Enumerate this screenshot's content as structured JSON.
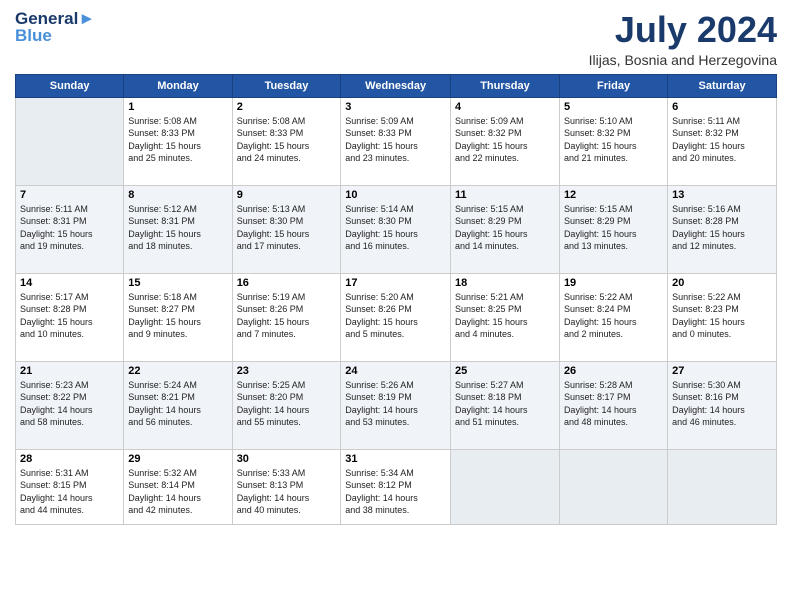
{
  "header": {
    "logo_general": "General",
    "logo_blue": "Blue",
    "title": "July 2024",
    "location": "Ilijas, Bosnia and Herzegovina"
  },
  "days_of_week": [
    "Sunday",
    "Monday",
    "Tuesday",
    "Wednesday",
    "Thursday",
    "Friday",
    "Saturday"
  ],
  "weeks": [
    [
      {
        "num": "",
        "info": ""
      },
      {
        "num": "1",
        "info": "Sunrise: 5:08 AM\nSunset: 8:33 PM\nDaylight: 15 hours\nand 25 minutes."
      },
      {
        "num": "2",
        "info": "Sunrise: 5:08 AM\nSunset: 8:33 PM\nDaylight: 15 hours\nand 24 minutes."
      },
      {
        "num": "3",
        "info": "Sunrise: 5:09 AM\nSunset: 8:33 PM\nDaylight: 15 hours\nand 23 minutes."
      },
      {
        "num": "4",
        "info": "Sunrise: 5:09 AM\nSunset: 8:32 PM\nDaylight: 15 hours\nand 22 minutes."
      },
      {
        "num": "5",
        "info": "Sunrise: 5:10 AM\nSunset: 8:32 PM\nDaylight: 15 hours\nand 21 minutes."
      },
      {
        "num": "6",
        "info": "Sunrise: 5:11 AM\nSunset: 8:32 PM\nDaylight: 15 hours\nand 20 minutes."
      }
    ],
    [
      {
        "num": "7",
        "info": "Sunrise: 5:11 AM\nSunset: 8:31 PM\nDaylight: 15 hours\nand 19 minutes."
      },
      {
        "num": "8",
        "info": "Sunrise: 5:12 AM\nSunset: 8:31 PM\nDaylight: 15 hours\nand 18 minutes."
      },
      {
        "num": "9",
        "info": "Sunrise: 5:13 AM\nSunset: 8:30 PM\nDaylight: 15 hours\nand 17 minutes."
      },
      {
        "num": "10",
        "info": "Sunrise: 5:14 AM\nSunset: 8:30 PM\nDaylight: 15 hours\nand 16 minutes."
      },
      {
        "num": "11",
        "info": "Sunrise: 5:15 AM\nSunset: 8:29 PM\nDaylight: 15 hours\nand 14 minutes."
      },
      {
        "num": "12",
        "info": "Sunrise: 5:15 AM\nSunset: 8:29 PM\nDaylight: 15 hours\nand 13 minutes."
      },
      {
        "num": "13",
        "info": "Sunrise: 5:16 AM\nSunset: 8:28 PM\nDaylight: 15 hours\nand 12 minutes."
      }
    ],
    [
      {
        "num": "14",
        "info": "Sunrise: 5:17 AM\nSunset: 8:28 PM\nDaylight: 15 hours\nand 10 minutes."
      },
      {
        "num": "15",
        "info": "Sunrise: 5:18 AM\nSunset: 8:27 PM\nDaylight: 15 hours\nand 9 minutes."
      },
      {
        "num": "16",
        "info": "Sunrise: 5:19 AM\nSunset: 8:26 PM\nDaylight: 15 hours\nand 7 minutes."
      },
      {
        "num": "17",
        "info": "Sunrise: 5:20 AM\nSunset: 8:26 PM\nDaylight: 15 hours\nand 5 minutes."
      },
      {
        "num": "18",
        "info": "Sunrise: 5:21 AM\nSunset: 8:25 PM\nDaylight: 15 hours\nand 4 minutes."
      },
      {
        "num": "19",
        "info": "Sunrise: 5:22 AM\nSunset: 8:24 PM\nDaylight: 15 hours\nand 2 minutes."
      },
      {
        "num": "20",
        "info": "Sunrise: 5:22 AM\nSunset: 8:23 PM\nDaylight: 15 hours\nand 0 minutes."
      }
    ],
    [
      {
        "num": "21",
        "info": "Sunrise: 5:23 AM\nSunset: 8:22 PM\nDaylight: 14 hours\nand 58 minutes."
      },
      {
        "num": "22",
        "info": "Sunrise: 5:24 AM\nSunset: 8:21 PM\nDaylight: 14 hours\nand 56 minutes."
      },
      {
        "num": "23",
        "info": "Sunrise: 5:25 AM\nSunset: 8:20 PM\nDaylight: 14 hours\nand 55 minutes."
      },
      {
        "num": "24",
        "info": "Sunrise: 5:26 AM\nSunset: 8:19 PM\nDaylight: 14 hours\nand 53 minutes."
      },
      {
        "num": "25",
        "info": "Sunrise: 5:27 AM\nSunset: 8:18 PM\nDaylight: 14 hours\nand 51 minutes."
      },
      {
        "num": "26",
        "info": "Sunrise: 5:28 AM\nSunset: 8:17 PM\nDaylight: 14 hours\nand 48 minutes."
      },
      {
        "num": "27",
        "info": "Sunrise: 5:30 AM\nSunset: 8:16 PM\nDaylight: 14 hours\nand 46 minutes."
      }
    ],
    [
      {
        "num": "28",
        "info": "Sunrise: 5:31 AM\nSunset: 8:15 PM\nDaylight: 14 hours\nand 44 minutes."
      },
      {
        "num": "29",
        "info": "Sunrise: 5:32 AM\nSunset: 8:14 PM\nDaylight: 14 hours\nand 42 minutes."
      },
      {
        "num": "30",
        "info": "Sunrise: 5:33 AM\nSunset: 8:13 PM\nDaylight: 14 hours\nand 40 minutes."
      },
      {
        "num": "31",
        "info": "Sunrise: 5:34 AM\nSunset: 8:12 PM\nDaylight: 14 hours\nand 38 minutes."
      },
      {
        "num": "",
        "info": ""
      },
      {
        "num": "",
        "info": ""
      },
      {
        "num": "",
        "info": ""
      }
    ]
  ]
}
